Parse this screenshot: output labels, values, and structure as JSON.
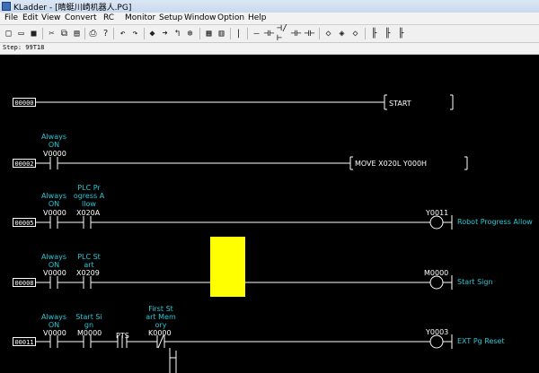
{
  "window": {
    "title": "KLadder - [睛蜓川崎机器人.PG]"
  },
  "menu": [
    "File",
    "Edit",
    "View",
    "Convert",
    "RC",
    "Monitor",
    "Setup",
    "Window",
    "Option",
    "Help"
  ],
  "toolbar_icons": [
    "new-icon",
    "open-icon",
    "save-icon",
    "cut-icon",
    "copy-icon",
    "paste-icon",
    "print-icon",
    "help-icon",
    "undo-icon",
    "redo-icon",
    "step-fwd-icon",
    "step-back-icon",
    "rotate-icon",
    "zoom-icon",
    "monitor-icon",
    "monitor2-icon",
    "vertical-line-icon",
    "horizontal-line-icon",
    "contact-no-icon",
    "contact-nc-icon",
    "contact-p-icon",
    "contact-n-icon",
    "coil-icon",
    "coil-nc-icon",
    "coil-set-icon",
    "branch-1-icon",
    "branch-2-icon",
    "branch-3-icon"
  ],
  "step_info": "Step:  99T18",
  "rungs": [
    {
      "step": "00000",
      "function": "START"
    },
    {
      "step": "00002",
      "contact_comment": [
        "Always",
        "ON"
      ],
      "contact": "V0000",
      "function": "MOVE    X020L   Y000H"
    },
    {
      "step": "00005",
      "contacts": [
        {
          "comment": [
            "Always",
            "ON"
          ],
          "addr": "V0000"
        },
        {
          "comment": [
            "PLC Pr",
            "ogress A",
            "llow"
          ],
          "addr": "X020A"
        }
      ],
      "coil": "Y0011",
      "coil_comment": "Robot Progress Allow"
    },
    {
      "step": "00008",
      "contacts": [
        {
          "comment": [
            "Always",
            "ON"
          ],
          "addr": "V0000"
        },
        {
          "comment": [
            "PLC St",
            "art"
          ],
          "addr": "X0209"
        }
      ],
      "coil": "M0000",
      "coil_comment": "Start Sign"
    },
    {
      "step": "00011",
      "contacts": [
        {
          "comment": [
            "Always",
            "ON"
          ],
          "addr": "V0000"
        },
        {
          "comment": [
            "Start Si",
            "gn"
          ],
          "addr": "M0000"
        },
        {
          "comment": [],
          "addr": "PTS"
        },
        {
          "comment": [
            "First St",
            "art Mem",
            "ory"
          ],
          "addr": "K0000"
        }
      ],
      "coil": "Y0003",
      "coil_comment": "EXT Pg Reset"
    }
  ],
  "colors": {
    "background": "#000000",
    "rung": "#ffffff",
    "comment": "#27c9d6",
    "cursor": "#ffff00"
  }
}
